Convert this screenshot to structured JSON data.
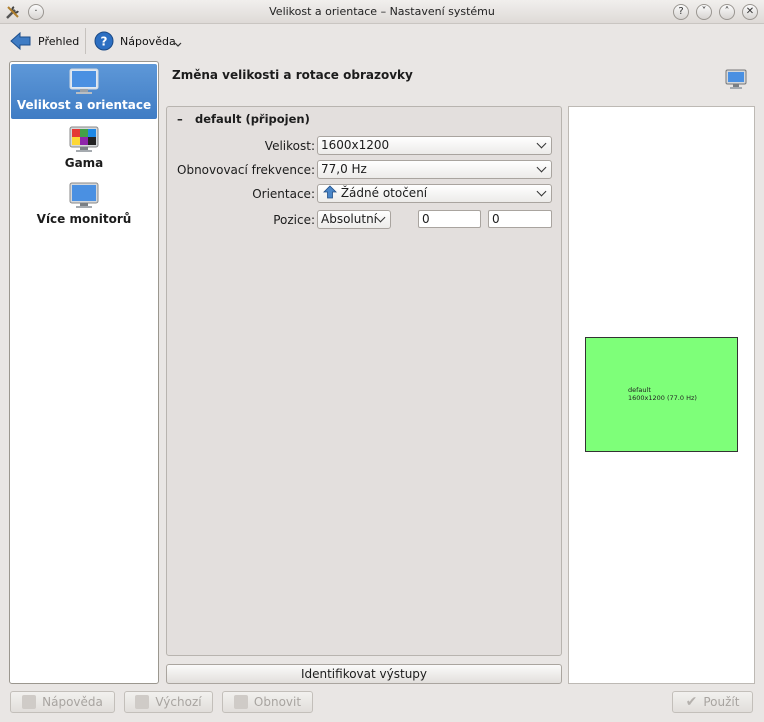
{
  "window": {
    "title": "Velikost a orientace – Nastavení systému",
    "buttons": [
      "?",
      "˅",
      "˄",
      "✕"
    ]
  },
  "toolbar": {
    "back_label": "Přehled",
    "help_label": "Nápověda"
  },
  "sidebar": {
    "items": [
      {
        "label": "Velikost a orientace",
        "icon": "monitor-icon",
        "selected": true
      },
      {
        "label": "Gama",
        "icon": "gamma-monitor-icon",
        "selected": false
      },
      {
        "label": "Více monitorů",
        "icon": "monitor-icon",
        "selected": false
      }
    ]
  },
  "main": {
    "title": "Změna velikosti a rotace obrazovky",
    "group_title": "default (připojen)",
    "collapse_symbol": "–",
    "fields": {
      "size_label": "Velikost:",
      "size_value": "1600x1200",
      "refresh_label": "Obnovovací frekvence:",
      "refresh_value": "77,0 Hz",
      "orientation_label": "Orientace:",
      "orientation_value": "Žádné otočení",
      "position_label": "Pozice:",
      "position_mode": "Absolutní",
      "position_x": "0",
      "position_y": "0"
    },
    "identify_button": "Identifikovat výstupy"
  },
  "preview": {
    "output_name": "default",
    "output_info": "1600x1200 (77.0 Hz)",
    "color": "#7eff79"
  },
  "footer": {
    "help": "Nápověda",
    "defaults": "Výchozí",
    "reset": "Obnovit",
    "apply": "Použít"
  },
  "colors": {
    "selection": "#3f7cc4",
    "background": "#e9e6e4"
  }
}
